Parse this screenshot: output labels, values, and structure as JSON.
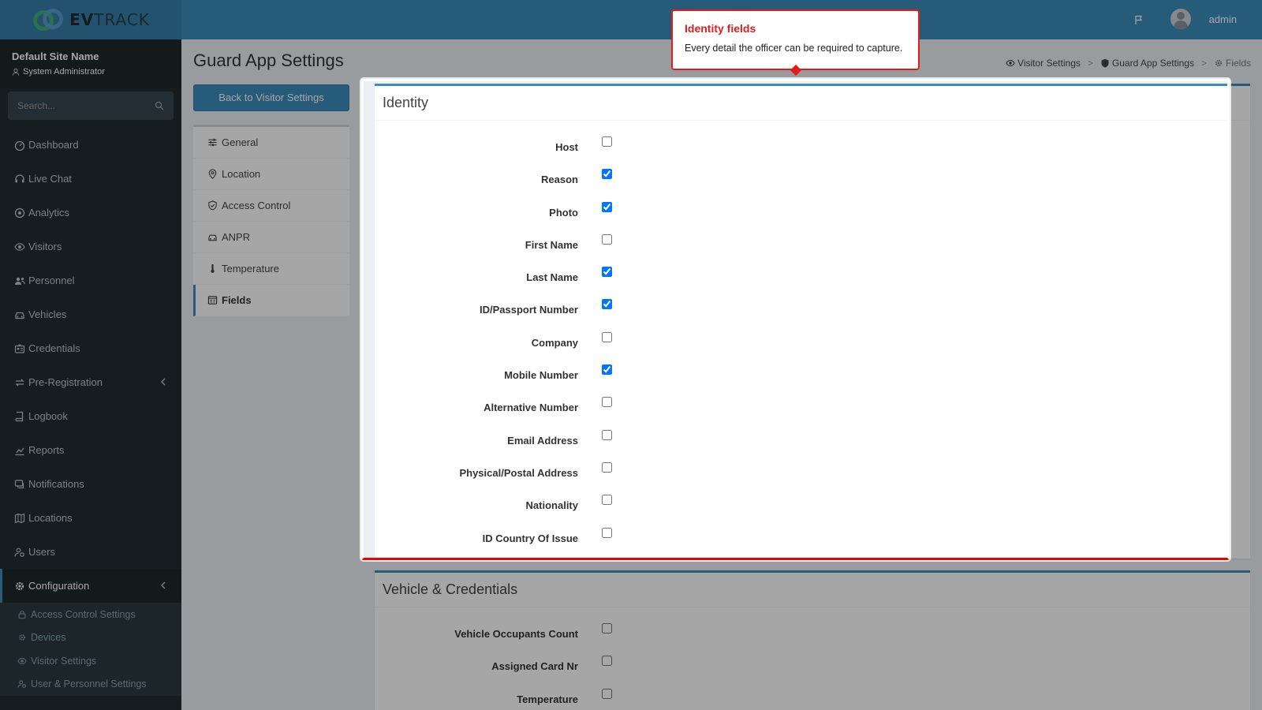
{
  "brand": {
    "name_bold": "EV",
    "name_rest": "TRACK"
  },
  "user_panel": {
    "site_name": "Default Site Name",
    "role": "System Administrator"
  },
  "search": {
    "placeholder": "Search..."
  },
  "sidebar": {
    "items": [
      {
        "label": "Dashboard",
        "icon": "dashboard-icon"
      },
      {
        "label": "Live Chat",
        "icon": "headset-icon"
      },
      {
        "label": "Analytics",
        "icon": "target-icon"
      },
      {
        "label": "Visitors",
        "icon": "eye-icon"
      },
      {
        "label": "Personnel",
        "icon": "users-icon"
      },
      {
        "label": "Vehicles",
        "icon": "car-icon"
      },
      {
        "label": "Credentials",
        "icon": "id-card-icon"
      },
      {
        "label": "Pre-Registration",
        "icon": "exchange-icon"
      },
      {
        "label": "Logbook",
        "icon": "book-icon"
      },
      {
        "label": "Reports",
        "icon": "chart-icon"
      },
      {
        "label": "Notifications",
        "icon": "chat-icon"
      },
      {
        "label": "Locations",
        "icon": "map-icon"
      },
      {
        "label": "Users",
        "icon": "user-cog-icon"
      },
      {
        "label": "Configuration",
        "icon": "gear-icon"
      }
    ],
    "submenu": [
      {
        "label": "Access Control Settings",
        "icon": "lock-icon"
      },
      {
        "label": "Devices",
        "icon": "devices-icon"
      },
      {
        "label": "Visitor Settings",
        "icon": "eye-icon"
      },
      {
        "label": "User & Personnel Settings",
        "icon": "user-cog-icon"
      }
    ]
  },
  "header": {
    "username": "admin"
  },
  "page": {
    "title": "Guard App Settings",
    "back_button": "Back to Visitor Settings",
    "breadcrumb": [
      "Visitor Settings",
      "Guard App Settings",
      "Fields"
    ]
  },
  "settings_nav": [
    {
      "label": "General",
      "icon": "sliders-icon"
    },
    {
      "label": "Location",
      "icon": "map-pin-icon"
    },
    {
      "label": "Access Control",
      "icon": "shield-check-icon"
    },
    {
      "label": "ANPR",
      "icon": "car-icon"
    },
    {
      "label": "Temperature",
      "icon": "thermometer-icon"
    },
    {
      "label": "Fields",
      "icon": "form-icon"
    }
  ],
  "identity": {
    "title": "Identity",
    "fields": [
      {
        "label": "Host",
        "checked": false
      },
      {
        "label": "Reason",
        "checked": true
      },
      {
        "label": "Photo",
        "checked": true
      },
      {
        "label": "First Name",
        "checked": false
      },
      {
        "label": "Last Name",
        "checked": true
      },
      {
        "label": "ID/Passport Number",
        "checked": true
      },
      {
        "label": "Company",
        "checked": false
      },
      {
        "label": "Mobile Number",
        "checked": true
      },
      {
        "label": "Alternative Number",
        "checked": false
      },
      {
        "label": "Email Address",
        "checked": false
      },
      {
        "label": "Physical/Postal Address",
        "checked": false
      },
      {
        "label": "Nationality",
        "checked": false
      },
      {
        "label": "ID Country Of Issue",
        "checked": false
      }
    ]
  },
  "vehicle": {
    "title": "Vehicle & Credentials",
    "fields": [
      {
        "label": "Vehicle Occupants Count",
        "checked": false
      },
      {
        "label": "Assigned Card Nr",
        "checked": false
      },
      {
        "label": "Temperature",
        "checked": false
      }
    ]
  },
  "tooltip": {
    "title": "Identity fields",
    "text": "Every detail the officer can be required to capture."
  },
  "colors": {
    "primary": "#3c8dbc",
    "sidebar": "#222d32",
    "highlight": "#e31b1b"
  }
}
